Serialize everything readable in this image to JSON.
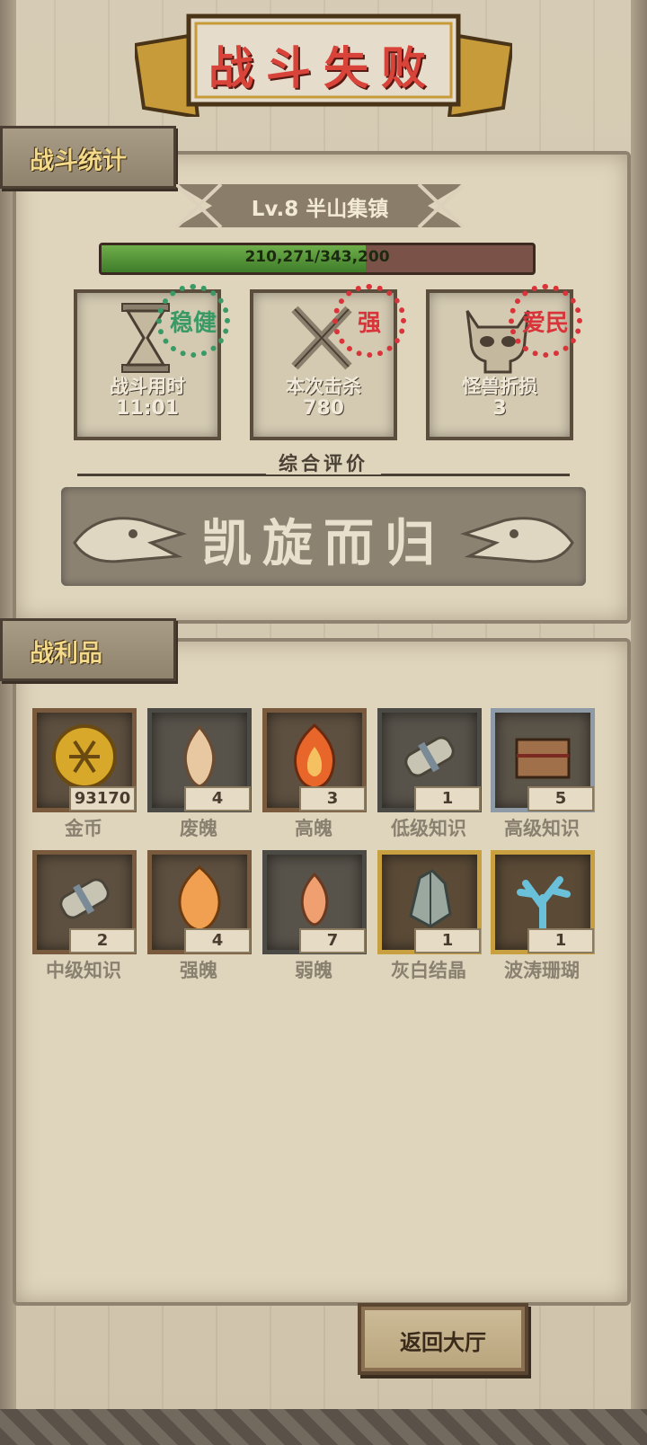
{
  "title": "战斗失败",
  "stats_section": {
    "tab_label": "战斗统计",
    "level_label": "Lv.8 半山集镇",
    "progress_text": "210,271/343,200",
    "progress_fraction": 0.613,
    "cards": [
      {
        "label": "战斗用时",
        "value": "11:01",
        "stamp": "稳健",
        "stamp_color": "#3a9a66",
        "icon": "hourglass-icon"
      },
      {
        "label": "本次击杀",
        "value": "780",
        "stamp": "强",
        "stamp_color": "#d8343a",
        "icon": "crossed-swords-icon"
      },
      {
        "label": "怪兽折损",
        "value": "3",
        "stamp": "爱民",
        "stamp_color": "#d8343a",
        "icon": "skull-icon"
      }
    ],
    "rating_caption": "综合评价",
    "rating_value": "凯旋而归"
  },
  "loot_section": {
    "tab_label": "战利品",
    "items": [
      {
        "name": "金币",
        "qty": "93170",
        "icon": "gold-coin-icon",
        "frame": "bronze"
      },
      {
        "name": "废魄",
        "qty": "4",
        "icon": "pale-flame-icon",
        "frame": "gray"
      },
      {
        "name": "高魄",
        "qty": "3",
        "icon": "red-flame-icon",
        "frame": "bronze"
      },
      {
        "name": "低级知识",
        "qty": "1",
        "icon": "scroll-icon",
        "frame": "gray"
      },
      {
        "name": "高级知识",
        "qty": "5",
        "icon": "book-icon",
        "frame": "silver"
      },
      {
        "name": "中级知识",
        "qty": "2",
        "icon": "scroll-icon",
        "frame": "bronze"
      },
      {
        "name": "强魄",
        "qty": "4",
        "icon": "orange-flame-icon",
        "frame": "bronze"
      },
      {
        "name": "弱魄",
        "qty": "7",
        "icon": "small-flame-icon",
        "frame": "gray"
      },
      {
        "name": "灰白结晶",
        "qty": "1",
        "icon": "crystal-icon",
        "frame": "gold"
      },
      {
        "name": "波涛珊瑚",
        "qty": "1",
        "icon": "coral-icon",
        "frame": "gold"
      }
    ]
  },
  "return_button": "返回大厅"
}
